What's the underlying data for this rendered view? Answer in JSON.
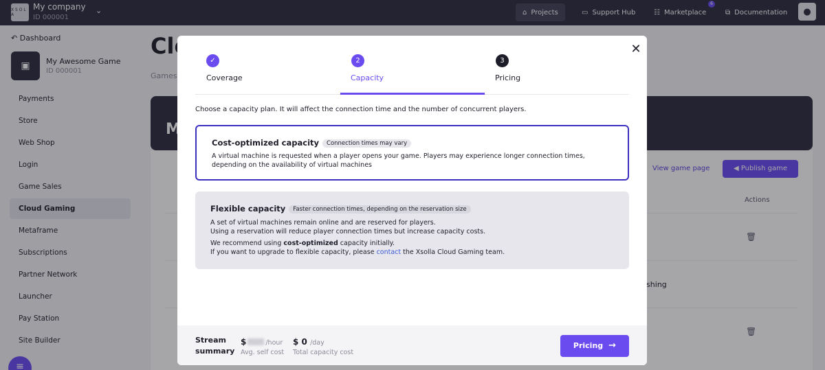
{
  "topbar": {
    "company_name": "My company",
    "company_id": "ID 000001",
    "logo_text": "X S O L A",
    "nav": {
      "projects": "Projects",
      "support_hub": "Support Hub",
      "marketplace": "Marketplace",
      "marketplace_badge": "6",
      "documentation": "Documentation"
    }
  },
  "sidebar": {
    "dashboard_label": "Dashboard",
    "game_name": "My Awesome Game",
    "game_id": "ID 000001",
    "items": [
      {
        "label": "Payments"
      },
      {
        "label": "Store"
      },
      {
        "label": "Web Shop"
      },
      {
        "label": "Login"
      },
      {
        "label": "Game Sales"
      },
      {
        "label": "Cloud Gaming"
      },
      {
        "label": "Metaframe"
      },
      {
        "label": "Subscriptions"
      },
      {
        "label": "Partner Network"
      },
      {
        "label": "Launcher"
      },
      {
        "label": "Pay Station"
      },
      {
        "label": "Site Builder"
      }
    ]
  },
  "background": {
    "page_title": "Clo",
    "breadcrumb": "Games",
    "hero_text": "M",
    "view_game_page": "View game page",
    "publish_game": "Publish game",
    "actions_header": "Actions",
    "status_2": "ishing"
  },
  "modal": {
    "steps": [
      {
        "number": "✓",
        "label": "Coverage"
      },
      {
        "number": "2",
        "label": "Capacity"
      },
      {
        "number": "3",
        "label": "Pricing"
      }
    ],
    "intro": "Choose a capacity plan. It will affect the connection time and the number of concurrent players.",
    "cost_optimized": {
      "title": "Cost-optimized capacity",
      "badge": "Connection times may vary",
      "text": "A virtual machine is requested when a player opens your game. Players may experience longer connection times, depending on the availability of virtual machines"
    },
    "flexible": {
      "title": "Flexible capacity",
      "badge": "Faster connection times, depending on the reservation size",
      "line1": "A set of virtual machines remain online and are reserved for players.",
      "line2": "Using a reservation will reduce player connection times but increase capacity costs.",
      "line3_prefix": "We recommend using",
      "line3_bold": "cost-optimized",
      "line3_suffix": "capacity initially.",
      "line4_prefix": "If you want to upgrade to flexible capacity, please",
      "line4_link": "contact",
      "line4_suffix": "the Xsolla Cloud Gaming team."
    },
    "footer": {
      "summary_title": "Stream summary",
      "self_cost_currency": "$",
      "self_cost_unit": "/hour",
      "self_cost_label": "Avg. self cost",
      "total_value": "$ 0",
      "total_unit": "/day",
      "total_label": "Total capacity cost",
      "pricing_button": "Pricing"
    }
  },
  "colors": {
    "accent": "#6a4bf0",
    "topbar": "#2d2c3e",
    "selected_border": "#3b2fc2",
    "link": "#3b5bd6"
  }
}
